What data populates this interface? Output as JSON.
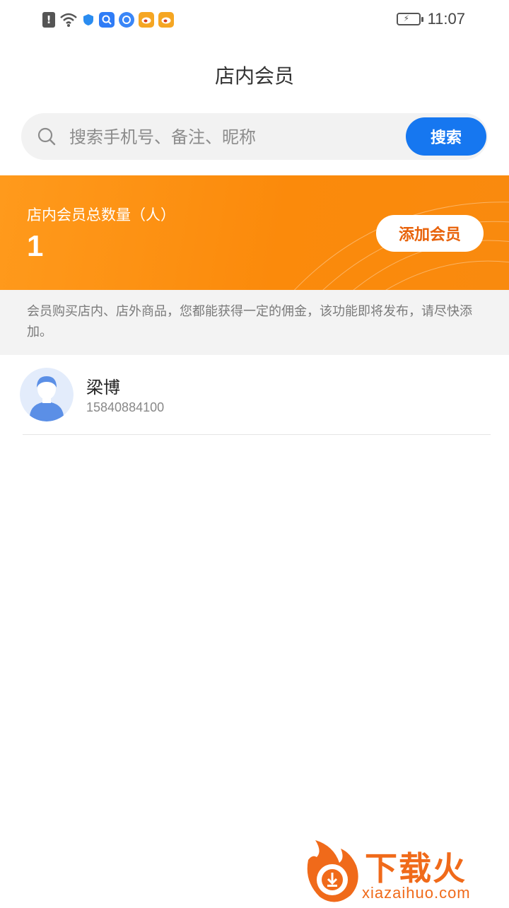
{
  "status_bar": {
    "time": "11:07",
    "icons": [
      "alert-icon",
      "wifi-icon",
      "shield-icon",
      "app-notification-icon",
      "app-notification-icon",
      "weibo-icon",
      "weibo-icon"
    ]
  },
  "header": {
    "title": "店内会员"
  },
  "search": {
    "placeholder": "搜索手机号、备注、昵称",
    "value": "",
    "button_label": "搜索"
  },
  "banner": {
    "label": "店内会员总数量（人）",
    "count": "1",
    "add_button_label": "添加会员"
  },
  "notice": {
    "text": "会员购买店内、店外商品，您都能获得一定的佣金，该功能即将发布，请尽快添加。"
  },
  "members": [
    {
      "name": "梁博",
      "phone": "15840884100"
    }
  ],
  "watermark": {
    "name": "下载火",
    "url": "xiazaihuo.com"
  },
  "colors": {
    "accent_blue": "#1677f0",
    "banner_orange": "#fb8a0b",
    "add_button_text": "#e8620a",
    "watermark": "#f06a1a"
  }
}
